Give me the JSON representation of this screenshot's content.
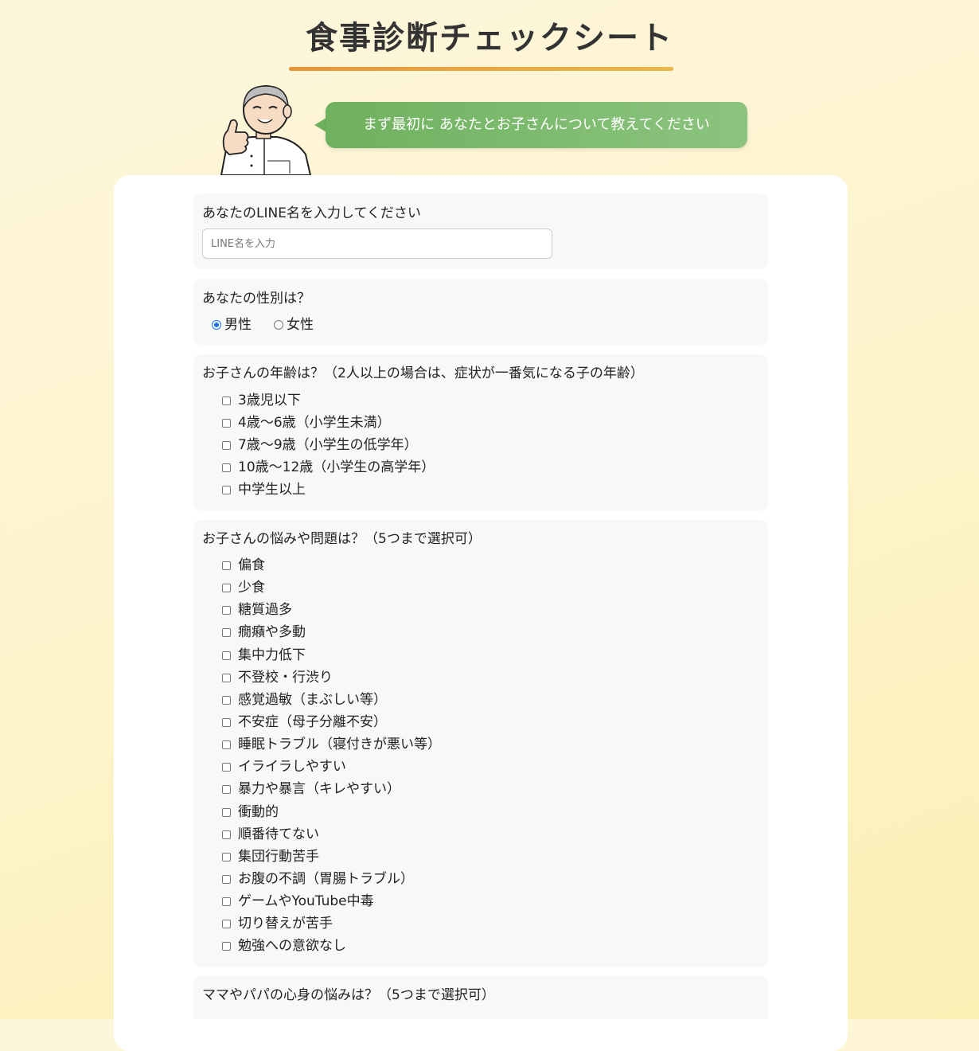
{
  "page": {
    "title": "食事診断チェックシート",
    "intro_bubble": "まず最初に あなたとお子さんについて教えてください"
  },
  "form": {
    "line_name": {
      "label": "あなたのLINE名を入力してください",
      "placeholder": "LINE名を入力",
      "value": ""
    },
    "gender": {
      "label": "あなたの性別は？",
      "options": [
        {
          "label": "男性",
          "checked": true
        },
        {
          "label": "女性",
          "checked": false
        }
      ]
    },
    "child_age": {
      "label": "お子さんの年齢は？（2人以上の場合は、症状が一番気になる子の年齢）",
      "options": [
        "3歳児以下",
        "4歳〜6歳（小学生未満）",
        "7歳〜9歳（小学生の低学年）",
        "10歳〜12歳（小学生の高学年）",
        "中学生以上"
      ]
    },
    "child_problems": {
      "label": "お子さんの悩みや問題は？（5つまで選択可）",
      "options": [
        "偏食",
        "少食",
        "糖質過多",
        "癇癪や多動",
        "集中力低下",
        "不登校・行渋り",
        "感覚過敏（まぶしい等）",
        "不安症（母子分離不安）",
        "睡眠トラブル（寝付きが悪い等）",
        "イライラしやすい",
        "暴力や暴言（キレやすい）",
        "衝動的",
        "順番待てない",
        "集団行動苦手",
        "お腹の不調（胃腸トラブル）",
        "ゲームやYouTube中毒",
        "切り替えが苦手",
        "勉強への意欲なし"
      ]
    },
    "parent_problems": {
      "label": "ママやパパの心身の悩みは？（5つまで選択可）"
    }
  },
  "colors": {
    "title_underline": "#e8953a",
    "bubble": "#6fb15f",
    "radio_checked": "#1a73e8"
  }
}
